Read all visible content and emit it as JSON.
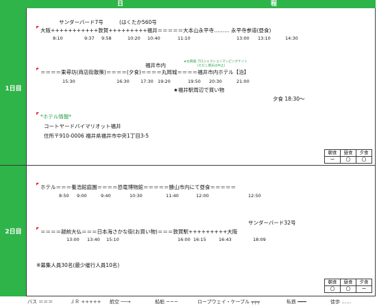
{
  "header": {
    "col1": "日",
    "col2": "程"
  },
  "days": [
    {
      "label": "1日目",
      "train1": "サンダーバード7号",
      "train2": "(はくたか560号",
      "route1": "大阪+++++++++++敦賀+++++++++福井＝＝＝＝＝大本山永平寺……… 永平寺参道(昼食)",
      "times1": [
        "8:10",
        "9:37",
        "9:58",
        "10:20",
        "10:40",
        "11:10",
        "13:00",
        "13:10",
        "14:30"
      ],
      "city_label": "福井市内",
      "projection_note": "★丸岡城:プロジェクションマッピングナイト",
      "projection_sub": "(ただし雨天は中止)",
      "route2": "＝＝＝＝東尋坊(商店街散策)＝＝＝＝(夕食)＝＝＝＝丸岡城＝＝＝＝福井市内ホテル【泊】",
      "times2": [
        "15:30",
        "16:30",
        "17:30",
        "19:20",
        "19:50",
        "20:30",
        "21:00"
      ],
      "shopping_note": "★福井駅周辺で買い物",
      "dinner_time": "夕食 18:30～",
      "hotel_title": "*ホテル情報*",
      "hotel_name": "コートヤードバイマリオット福井",
      "hotel_address": "住所〒910-0006 福井県福井市中央1丁目3-5",
      "meals": {
        "headers": [
          "朝食",
          "昼食",
          "夕食"
        ],
        "values": [
          "ー",
          "〇",
          "〇"
        ]
      }
    },
    {
      "label": "2日目",
      "route1": "ホテル＝＝＝養浩館庭園＝＝＝＝恐竜博物館＝＝＝＝＝勝山市内にて昼食＝＝＝＝＝",
      "times1": [
        "8:50",
        "9:00",
        "9:40",
        "10:30",
        "11:40",
        "12:00",
        "12:50"
      ],
      "train": "サンダーバード32号",
      "route2": "＝＝＝＝越前大仏＝＝＝日本海さかな街(お買い物)＝＝＝敦賀駅+++++++++大阪",
      "times2": [
        "13:00",
        "13:40",
        "15:10",
        "16:00",
        "16:15",
        "16:43",
        "18:09"
      ],
      "capacity_note": "※募集人員30名(最少催行人員10名)",
      "meals": {
        "headers": [
          "朝食",
          "昼食",
          "夕食"
        ],
        "values": [
          "〇",
          "〇",
          "ー"
        ]
      }
    }
  ],
  "legend": [
    "バス ＝＝＝",
    "ＪＲ +++++",
    "航空 ──→",
    "船舶 ~~~",
    "ロープウェイ・ケーブル ╤╤╤",
    "私鉄 ━━━",
    "徒歩 ……"
  ]
}
